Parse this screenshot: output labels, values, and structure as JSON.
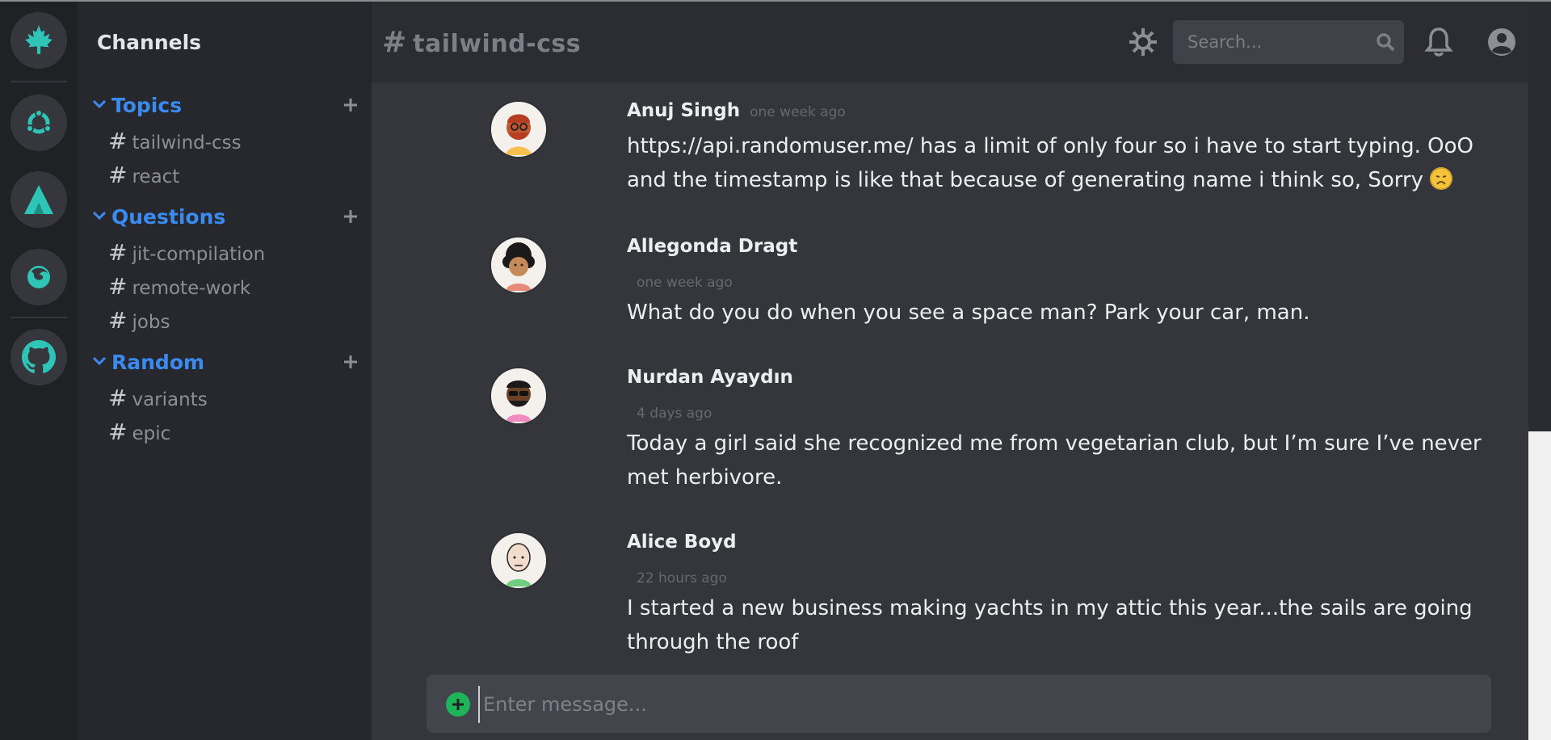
{
  "rail": {
    "servers": [
      {
        "name": "maple-leaf-icon"
      },
      {
        "name": "ubuntu-icon"
      },
      {
        "name": "atlassian-icon"
      },
      {
        "name": "firefox-icon"
      },
      {
        "name": "github-icon"
      }
    ],
    "accent": "#2ec4b6"
  },
  "sidebar": {
    "title": "Channels",
    "groups": [
      {
        "label": "Topics",
        "channels": [
          "tailwind-css",
          "react"
        ]
      },
      {
        "label": "Questions",
        "channels": [
          "jit-compilation",
          "remote-work",
          "jobs"
        ]
      },
      {
        "label": "Random",
        "channels": [
          "variants",
          "epic"
        ]
      }
    ],
    "hash": "#"
  },
  "header": {
    "hash": "#",
    "channel": "tailwind-css",
    "search_placeholder": "Search..."
  },
  "messages": [
    {
      "author": "Anuj Singh",
      "time": "one week ago",
      "text": "https://api.randomuser.me/ has a limit of only four so i have to start typing. OoO and the timestamp is like that because of generating name i think so, Sorry"
    },
    {
      "author": "Allegonda Dragt",
      "time": "one week ago",
      "text": "What do you do when you see a space man? Park your car, man."
    },
    {
      "author": "Nurdan Ayaydın",
      "time": "4 days ago",
      "text": "Today a girl said she recognized me from vegetarian club, but I’m sure I’ve never met herbivore."
    },
    {
      "author": "Alice Boyd",
      "time": "22 hours ago",
      "text": "I started a new business making yachts in my attic this year...the sails are going through the roof"
    }
  ],
  "composer": {
    "placeholder": "Enter message..."
  },
  "colors": {
    "accent_blue": "#3b8af0",
    "add_green": "#1fb45a"
  }
}
